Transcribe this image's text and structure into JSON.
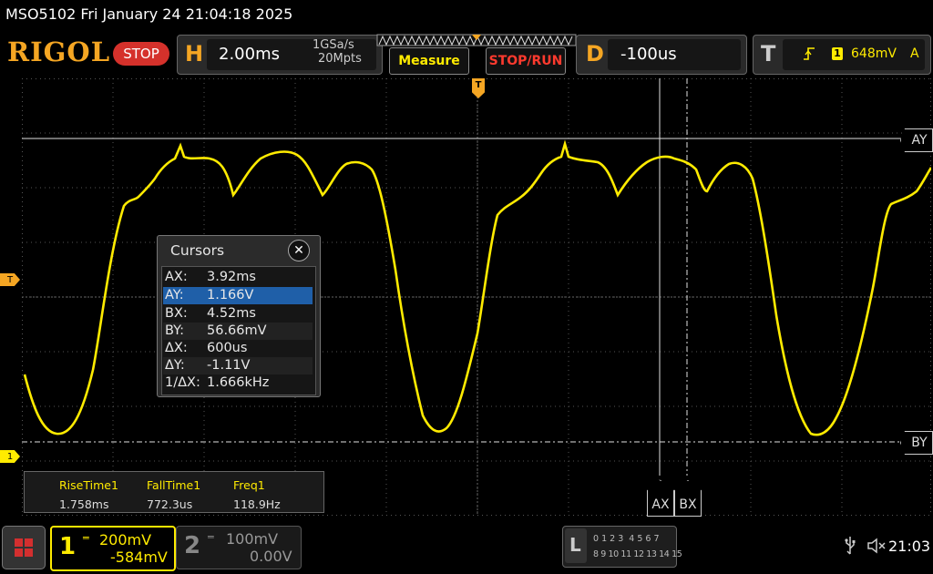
{
  "status_bar": {
    "title": "MSO5102  Fri January 24 21:04:18 2025"
  },
  "brand": {
    "logo": "RIGOL",
    "run_state": "STOP"
  },
  "horizontal": {
    "letter": "H",
    "timebase": "2.00ms",
    "sample_rate": "1GSa/s",
    "memory_depth": "20Mpts"
  },
  "buttons": {
    "measure": "Measure",
    "stop_run": "STOP/RUN"
  },
  "delay": {
    "letter": "D",
    "value": "-100us"
  },
  "trigger": {
    "letter": "T",
    "channel": "1",
    "level": "648mV",
    "mode": "A"
  },
  "markers": {
    "trigger_top": "T",
    "trigger_level": "T",
    "ch1_ground": "1"
  },
  "cursor_tags": {
    "ay": "AY",
    "by": "BY",
    "ax": "AX",
    "bx": "BX"
  },
  "cursors_dialog": {
    "title": "Cursors",
    "rows": [
      {
        "key": "AX:",
        "value": "3.92ms",
        "selected": false
      },
      {
        "key": "AY:",
        "value": "1.166V",
        "selected": true
      },
      {
        "key": "BX:",
        "value": "4.52ms",
        "selected": false
      },
      {
        "key": "BY:",
        "value": "56.66mV",
        "selected": false
      },
      {
        "key": "ΔX:",
        "value": "600us",
        "selected": false
      },
      {
        "key": "ΔY:",
        "value": "-1.11V",
        "selected": false
      },
      {
        "key": "1/ΔX:",
        "value": "1.666kHz",
        "selected": false
      }
    ]
  },
  "measurements": [
    {
      "name": "RiseTime1",
      "value": "1.758ms"
    },
    {
      "name": "FallTime1",
      "value": "772.3us"
    },
    {
      "name": "Freq1",
      "value": "118.9Hz"
    }
  ],
  "channel1": {
    "number": "1",
    "scale": "200mV",
    "offset": "-584mV"
  },
  "channel2": {
    "number": "2",
    "scale": "100mV",
    "offset": "0.00V"
  },
  "logic": {
    "letter": "L",
    "row1": "0 1 2 3  4 5 6 7",
    "row2": "8 9 10 11 12 13 14 15"
  },
  "system": {
    "time": "21:03"
  },
  "colors": {
    "ch1": "#ffeb00",
    "brand": "#f5a623",
    "stop": "#d5312b",
    "selected_row": "#1f5fa8"
  }
}
